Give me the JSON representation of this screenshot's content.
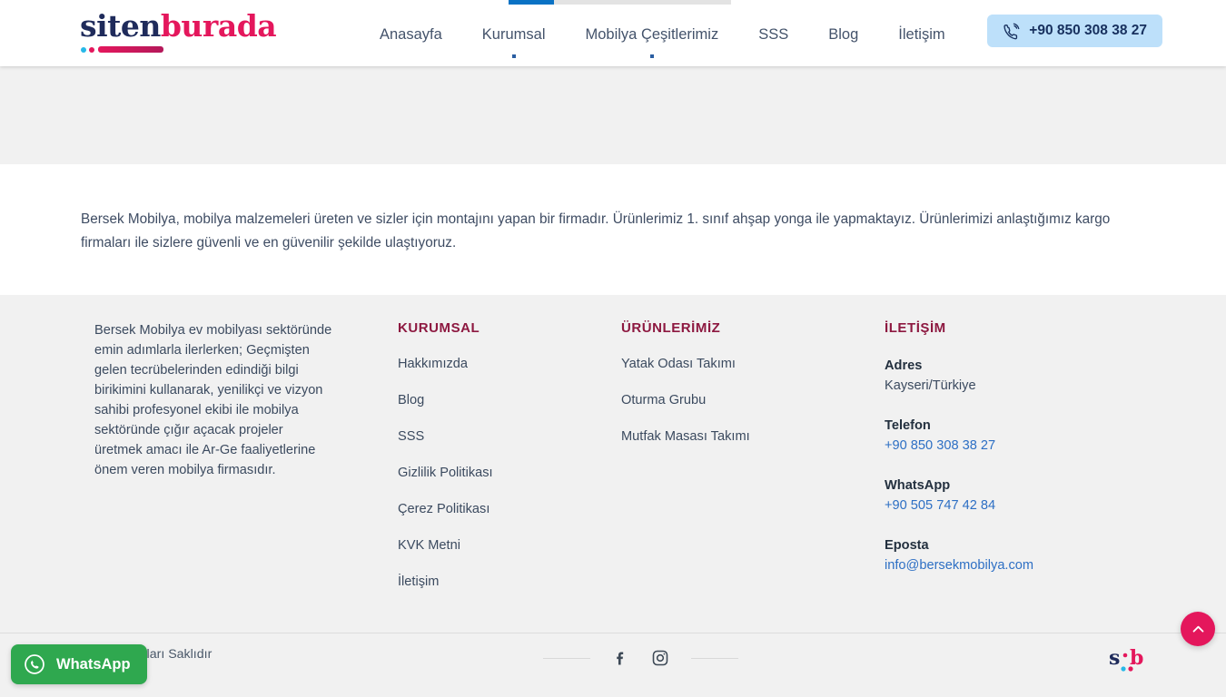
{
  "top_progress": {
    "fill_color": "#0a72c4",
    "track_color": "#e3e3e3"
  },
  "header": {
    "logo": {
      "part1": "siten",
      "part2": "burada",
      "alt": "sitenburada-logo"
    },
    "nav": [
      {
        "label": "Anasayfa",
        "has_dropdown": false
      },
      {
        "label": "Kurumsal",
        "has_dropdown": true
      },
      {
        "label": "Mobilya Çeşitlerimiz",
        "has_dropdown": true
      },
      {
        "label": "SSS",
        "has_dropdown": false
      },
      {
        "label": "Blog",
        "has_dropdown": false
      },
      {
        "label": "İletişim",
        "has_dropdown": false
      }
    ],
    "phone_button": {
      "label": "+90 850 308 38 27",
      "icon": "phone-icon",
      "bg": "#bde0fa"
    }
  },
  "intro": {
    "paragraph": "Bersek Mobilya, mobilya malzemeleri üreten ve sizler için montajını yapan bir firmadır. Ürünlerimiz 1. sınıf ahşap yonga ile yapmaktayız. Ürünlerimizi anlaştığımız kargo firmaları ile sizlere güvenli ve en güvenilir şekilde ulaştıyoruz."
  },
  "footer": {
    "about": {
      "text": "Bersek Mobilya ev mobilyası sektöründe emin adımlarla ilerlerken; Geçmişten gelen tecrübelerinden edindiği bilgi birikimini kullanarak, yenilikçi ve vizyon sahibi profesyonel ekibi ile mobilya sektöründe çığır açacak projeler üretmek amacı ile Ar-Ge faaliyetlerine önem veren mobilya firmasıdır."
    },
    "kurumsal": {
      "heading": "KURUMSAL",
      "links": [
        "Hakkımızda",
        "Blog",
        "SSS",
        "Gizlilik Politikası",
        "Çerez Politikası",
        "KVK Metni",
        "İletişim"
      ]
    },
    "urunlerimiz": {
      "heading": "ÜRÜNLERİMİZ",
      "links": [
        "Yatak Odası Takımı",
        "Oturma Grubu",
        "Mutfak Masası Takımı"
      ]
    },
    "iletisim": {
      "heading": "İLETİŞİM",
      "adres_label": "Adres",
      "adres_value": "Kayseri/Türkiye",
      "telefon_label": "Telefon",
      "telefon_value": "+90 850 308 38 27",
      "whatsapp_label": "WhatsApp",
      "whatsapp_value": "+90 505 747 42 84",
      "eposta_label": "Eposta",
      "eposta_value": "info@bersekmobilya.com",
      "link_color": "#2d6fc4",
      "heading_color": "#8d1840"
    }
  },
  "bottom_bar": {
    "copyright": "Tüm Hakları Saklıdır",
    "social": [
      {
        "name": "facebook-icon"
      },
      {
        "name": "instagram-icon"
      }
    ],
    "mini_logo": {
      "part1": "s",
      "part2": "b",
      "alt": "sb-mini-logo"
    }
  },
  "widgets": {
    "whatsapp": {
      "label": "WhatsApp",
      "bg": "#2fa84f",
      "icon": "whatsapp-icon"
    },
    "scroll_top": {
      "bg": "#e4175c",
      "icon": "chevron-up-icon"
    }
  }
}
